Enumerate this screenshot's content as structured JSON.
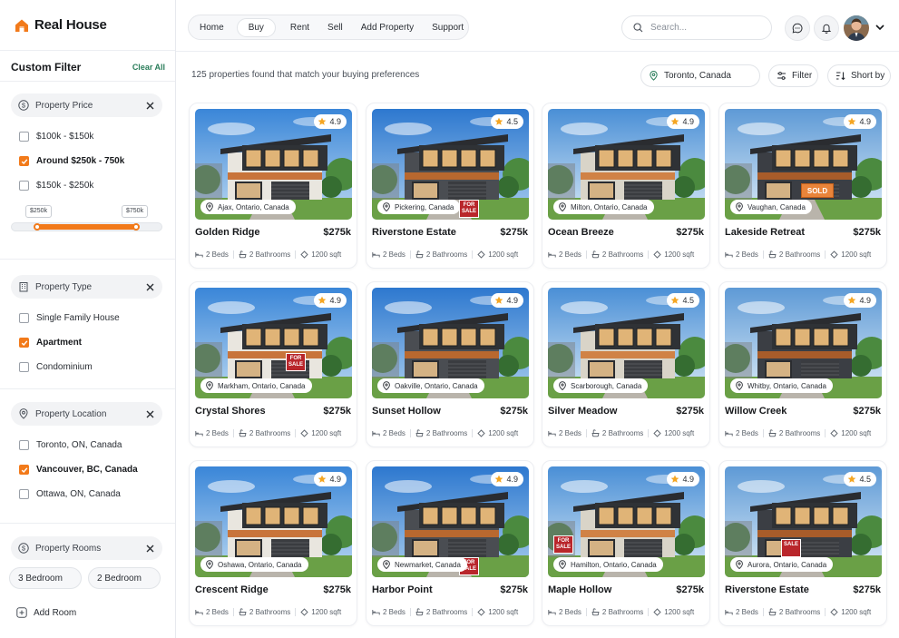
{
  "brand": {
    "name": "Real House",
    "accent": "#f27a1a"
  },
  "sidebar": {
    "title": "Custom Filter",
    "clear_label": "Clear All",
    "price": {
      "label": "Property Price",
      "options": [
        {
          "label": "$100k - $150k",
          "checked": false
        },
        {
          "label": "Around $250k - 750k",
          "checked": true
        },
        {
          "label": "$150k - $250k",
          "checked": false
        }
      ],
      "min_label": "$250k",
      "max_label": "$750k",
      "range_low_fraction": 0.17,
      "range_high_fraction": 0.82
    },
    "type": {
      "label": "Property Type",
      "options": [
        {
          "label": "Single Family House",
          "checked": false
        },
        {
          "label": "Apartment",
          "checked": true
        },
        {
          "label": "Condominium",
          "checked": false
        }
      ]
    },
    "location": {
      "label": "Property Location",
      "options": [
        {
          "label": "Toronto, ON, Canada",
          "checked": false
        },
        {
          "label": "Vancouver, BC, Canada",
          "checked": true
        },
        {
          "label": "Ottawa, ON, Canada",
          "checked": false
        }
      ]
    },
    "rooms": {
      "label": "Property Rooms",
      "options": [
        "3 Bedroom",
        "2 Bedroom"
      ],
      "add_label": "Add Room"
    }
  },
  "nav": {
    "items": [
      "Home",
      "Buy",
      "Rent",
      "Sell",
      "Add Property",
      "Support"
    ],
    "active": "Buy",
    "search_placeholder": "Search..."
  },
  "results": {
    "count_text": "125 properties found that match your buying preferences",
    "location": "Toronto, Canada",
    "filter_label": "Filter",
    "sort_label": "Short by"
  },
  "listings": [
    {
      "title": "Golden Ridge",
      "price": "$275k",
      "rating": "4.9",
      "location": "Ajax, Ontario, Canada",
      "beds": "2 Beds",
      "baths": "2 Bathrooms",
      "area": "1200 sqft",
      "tag": ""
    },
    {
      "title": "Riverstone Estate",
      "price": "$275k",
      "rating": "4.5",
      "location": "Pickering, Canada",
      "beds": "2 Beds",
      "baths": "2 Bathrooms",
      "area": "1200 sqft",
      "tag": "FOR SALE"
    },
    {
      "title": "Ocean Breeze",
      "price": "$275k",
      "rating": "4.9",
      "location": "Milton, Ontario, Canada",
      "beds": "2 Beds",
      "baths": "2 Bathrooms",
      "area": "1200 sqft",
      "tag": ""
    },
    {
      "title": "Lakeside Retreat",
      "price": "$275k",
      "rating": "4.9",
      "location": "Vaughan, Canada",
      "beds": "2 Beds",
      "baths": "2 Bathrooms",
      "area": "1200 sqft",
      "tag": "SOLD"
    },
    {
      "title": "Crystal Shores",
      "price": "$275k",
      "rating": "4.9",
      "location": "Markham, Ontario, Canada",
      "beds": "2 Beds",
      "baths": "2 Bathrooms",
      "area": "1200 sqft",
      "tag": "FOR SALE"
    },
    {
      "title": "Sunset Hollow",
      "price": "$275k",
      "rating": "4.9",
      "location": "Oakville, Ontario, Canada",
      "beds": "2 Beds",
      "baths": "2 Bathrooms",
      "area": "1200 sqft",
      "tag": ""
    },
    {
      "title": "Silver Meadow",
      "price": "$275k",
      "rating": "4.5",
      "location": "Scarborough, Canada",
      "beds": "2 Beds",
      "baths": "2 Bathrooms",
      "area": "1200 sqft",
      "tag": ""
    },
    {
      "title": "Willow Creek",
      "price": "$275k",
      "rating": "4.9",
      "location": "Whitby, Ontario, Canada",
      "beds": "2 Beds",
      "baths": "2 Bathrooms",
      "area": "1200 sqft",
      "tag": ""
    },
    {
      "title": "Crescent Ridge",
      "price": "$275k",
      "rating": "4.9",
      "location": "Oshawa, Ontario, Canada",
      "beds": "2 Beds",
      "baths": "2 Bathrooms",
      "area": "1200 sqft",
      "tag": ""
    },
    {
      "title": "Harbor Point",
      "price": "$275k",
      "rating": "4.9",
      "location": "Newmarket, Canada",
      "beds": "2 Beds",
      "baths": "2 Bathrooms",
      "area": "1200 sqft",
      "tag": "FOR SALE"
    },
    {
      "title": "Maple Hollow",
      "price": "$275k",
      "rating": "4.9",
      "location": "Hamilton, Ontario, Canada",
      "beds": "2 Beds",
      "baths": "2 Bathrooms",
      "area": "1200 sqft",
      "tag": "FOR SALE"
    },
    {
      "title": "Riverstone Estate",
      "price": "$275k",
      "rating": "4.5",
      "location": "Aurora, Ontario, Canada",
      "beds": "2 Beds",
      "baths": "2 Bathrooms",
      "area": "1200 sqft",
      "tag": "SALE"
    }
  ]
}
